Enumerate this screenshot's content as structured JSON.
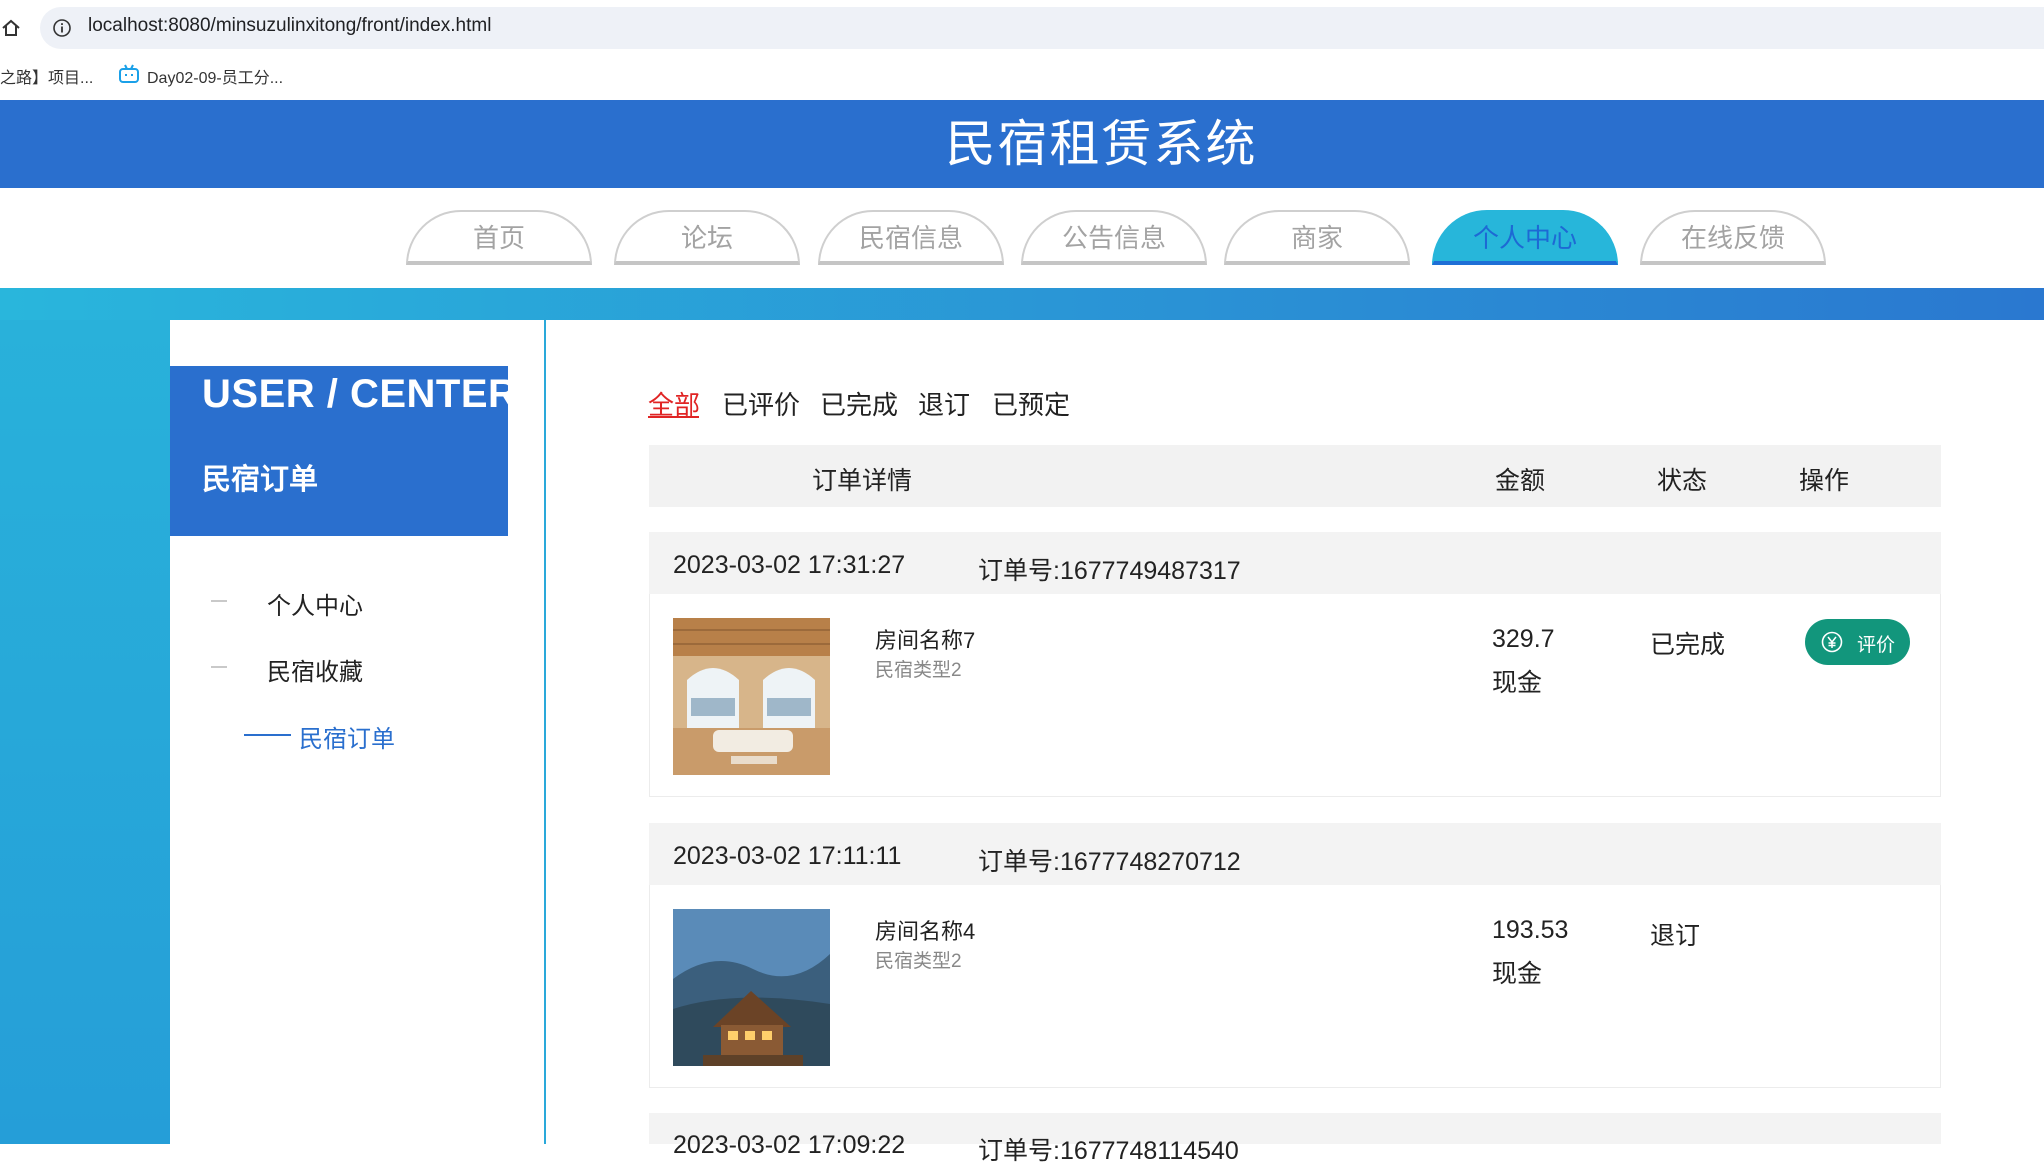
{
  "browser": {
    "url": "localhost:8080/minsuzulinxitong/front/index.html",
    "bookmarks": [
      {
        "label": "之路】项目..."
      },
      {
        "label": "Day02-09-员工分..."
      }
    ]
  },
  "header": {
    "title": "民宿租赁系统"
  },
  "nav": {
    "tabs": [
      {
        "label": "首页"
      },
      {
        "label": "论坛"
      },
      {
        "label": "民宿信息"
      },
      {
        "label": "公告信息"
      },
      {
        "label": "商家"
      },
      {
        "label": "个人中心"
      },
      {
        "label": "在线反馈"
      }
    ],
    "active_index": 5
  },
  "sidebar": {
    "title": "USER / CENTER",
    "subtitle": "民宿订单",
    "items": [
      {
        "label": "个人中心"
      },
      {
        "label": "民宿收藏"
      },
      {
        "label": "民宿订单"
      }
    ]
  },
  "filters": {
    "items": [
      {
        "label": "全部"
      },
      {
        "label": "已评价"
      },
      {
        "label": "已完成"
      },
      {
        "label": "退订"
      },
      {
        "label": "已预定"
      }
    ],
    "active_index": 0
  },
  "table": {
    "headers": {
      "detail": "订单详情",
      "amount": "金额",
      "status": "状态",
      "action": "操作"
    }
  },
  "orders": [
    {
      "date": "2023-03-02 17:31:27",
      "order_no": "订单号:1677749487317",
      "room_name": "房间名称7",
      "room_type": "民宿类型2",
      "amount": "329.7",
      "pay_type": "现金",
      "status": "已完成",
      "action_label": "评价"
    },
    {
      "date": "2023-03-02 17:11:11",
      "order_no": "订单号:1677748270712",
      "room_name": "房间名称4",
      "room_type": "民宿类型2",
      "amount": "193.53",
      "pay_type": "现金",
      "status": "退订"
    },
    {
      "date": "2023-03-02 17:09:22",
      "order_no": "订单号:1677748114540"
    }
  ],
  "colors": {
    "header_blue": "#2a6fce",
    "nav_active": "#27b6da",
    "filter_active": "#e02424",
    "rate_button": "#12967c"
  }
}
